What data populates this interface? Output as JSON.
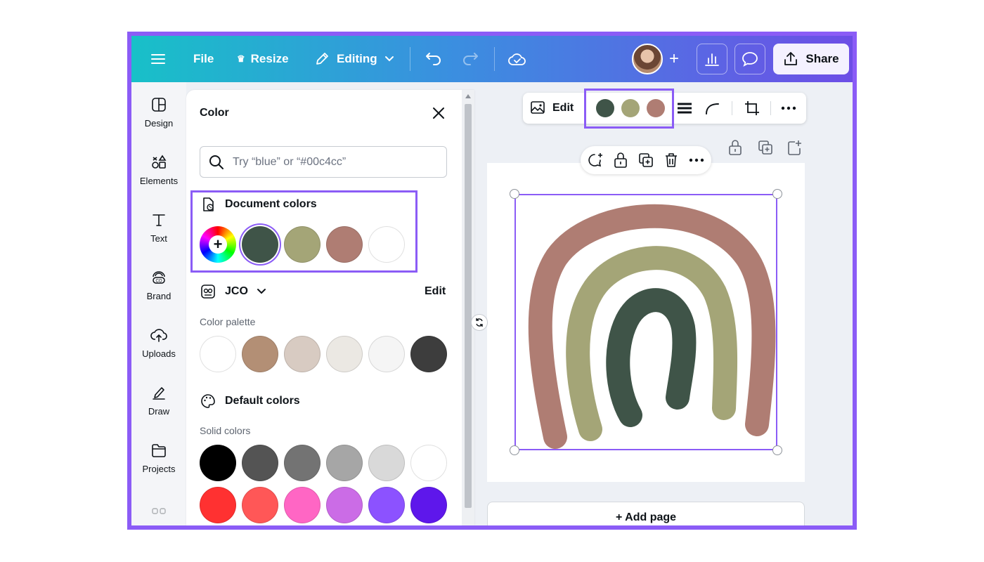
{
  "colors": {
    "accent": "#8b5cf6",
    "doc_dark_green": "#3f5448",
    "doc_olive": "#a4a577",
    "doc_rose": "#af7d73",
    "white": "#ffffff"
  },
  "topbar": {
    "menu_icon": "hamburger-icon",
    "file_label": "File",
    "resize_label": "Resize",
    "editing_label": "Editing",
    "share_label": "Share"
  },
  "leftrail": {
    "items": [
      {
        "label": "Design",
        "icon": "design-icon"
      },
      {
        "label": "Elements",
        "icon": "elements-icon"
      },
      {
        "label": "Text",
        "icon": "text-icon"
      },
      {
        "label": "Brand",
        "icon": "brand-icon"
      },
      {
        "label": "Uploads",
        "icon": "uploads-icon"
      },
      {
        "label": "Draw",
        "icon": "draw-icon"
      },
      {
        "label": "Projects",
        "icon": "projects-icon"
      }
    ]
  },
  "color_panel": {
    "title": "Color",
    "search_placeholder": "Try “blue” or “#00c4cc”",
    "document_colors": {
      "title": "Document colors",
      "swatches": [
        "#3f5448",
        "#a4a577",
        "#af7d73",
        "#ffffff"
      ],
      "selected_index": 0
    },
    "brand_kit": {
      "name": "JCO",
      "edit_label": "Edit",
      "palette_label": "Color palette",
      "swatches": [
        "#ffffff",
        "#b38f75",
        "#d8cbc2",
        "#ebe8e3",
        "#f5f5f5",
        "#3d3d3d"
      ]
    },
    "default_colors": {
      "title": "Default colors",
      "solid_label": "Solid colors",
      "row1": [
        "#000000",
        "#545454",
        "#737373",
        "#a6a6a6",
        "#d9d9d9",
        "#ffffff"
      ],
      "row2": [
        "#ff3131",
        "#ff5757",
        "#ff66c4",
        "#cb6ce6",
        "#8c52ff",
        "#5e17eb"
      ]
    }
  },
  "context_toolbar": {
    "edit_label": "Edit",
    "swatches": [
      "#3f5448",
      "#a4a577",
      "#af7d73"
    ]
  },
  "canvas": {
    "add_page_label": "+ Add page"
  }
}
